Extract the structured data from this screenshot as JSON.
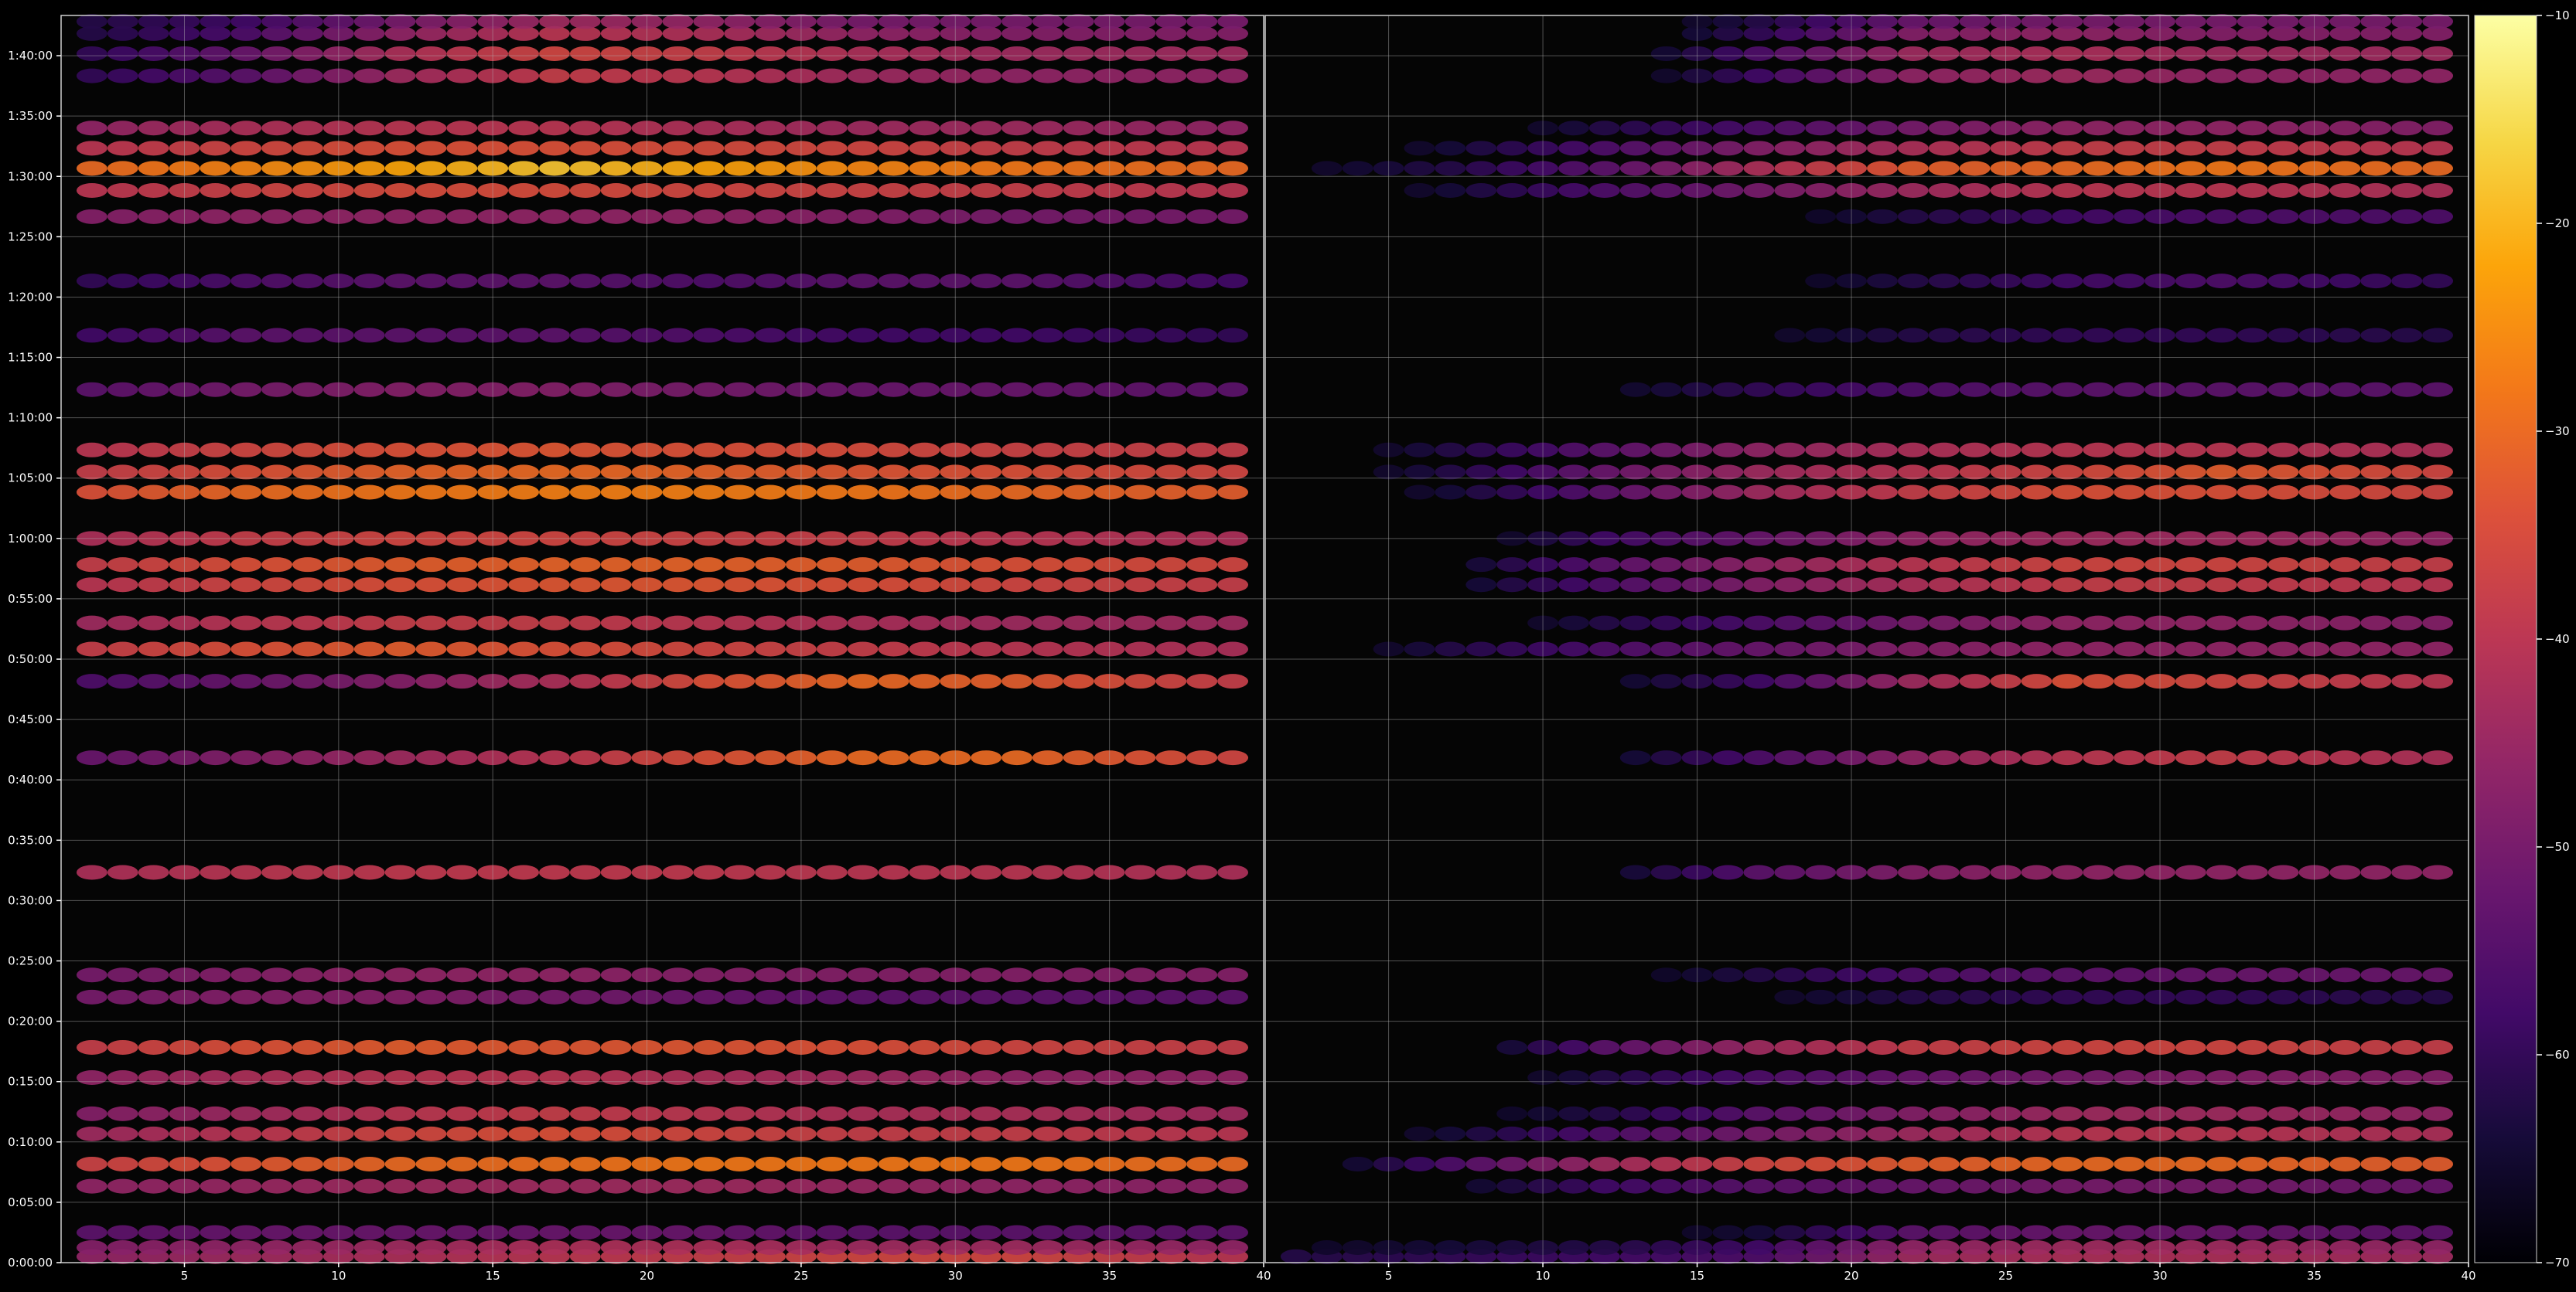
{
  "chart_data": {
    "type": "heatmap",
    "title": "",
    "colormap": "inferno",
    "background": "#000000",
    "grid": true,
    "grid_color": "#b4b4b4",
    "panels": [
      {
        "x_range": [
          1,
          40
        ],
        "xticks": [
          5,
          10,
          15,
          20,
          25,
          30,
          35,
          40
        ],
        "xtick_labels": [
          "5",
          "10",
          "15",
          "20",
          "25",
          "30",
          "35",
          "40"
        ]
      },
      {
        "x_range": [
          1,
          40
        ],
        "xticks": [
          5,
          10,
          15,
          20,
          25,
          30,
          35,
          40
        ],
        "xtick_labels": [
          "5",
          "10",
          "15",
          "20",
          "25",
          "30",
          "35",
          "40"
        ]
      }
    ],
    "y_range_seconds": [
      0,
      6200
    ],
    "ytick_labels": [
      "0:00:00",
      "0:05:00",
      "0:10:00",
      "0:15:00",
      "0:20:00",
      "0:25:00",
      "0:30:00",
      "0:35:00",
      "0:40:00",
      "0:45:00",
      "0:50:00",
      "0:55:00",
      "1:00:00",
      "1:05:00",
      "1:10:00",
      "1:15:00",
      "1:20:00",
      "1:25:00",
      "1:30:00",
      "1:35:00",
      "1:40:00"
    ],
    "ytick_seconds": [
      0,
      300,
      600,
      900,
      1200,
      1500,
      1800,
      2100,
      2400,
      2700,
      3000,
      3300,
      3600,
      3900,
      4200,
      4500,
      4800,
      5100,
      5400,
      5700,
      6000
    ],
    "colorbar": {
      "range": [
        -70,
        -10
      ],
      "ticks": [
        -70,
        -60,
        -50,
        -40,
        -30,
        -20,
        -10
      ],
      "tick_labels": [
        "−70",
        "−60",
        "−50",
        "−40",
        "−30",
        "−20",
        "−10"
      ]
    },
    "rows": [
      {
        "t": 30,
        "a": [
          -46,
          -44,
          -42,
          -40,
          -38,
          -36,
          -36,
          -40
        ],
        "b": [
          -62,
          -60,
          -58,
          -56,
          -44,
          -42,
          -42,
          -44
        ]
      },
      {
        "t": 75,
        "a": [
          -48,
          -46,
          -44,
          -42,
          -42,
          -44,
          -44,
          -46
        ],
        "b": [
          -66,
          -64,
          -62,
          -58,
          -46,
          -44,
          -44,
          -46
        ]
      },
      {
        "t": 150,
        "a": [
          -54,
          -52,
          -52,
          -52,
          -52,
          -54,
          -54,
          -54
        ],
        "b": [
          -70,
          -70,
          -68,
          -64,
          -54,
          -52,
          -52,
          -54
        ]
      },
      {
        "t": 380,
        "a": [
          -46,
          -45,
          -44,
          -44,
          -44,
          -45,
          -46,
          -47
        ],
        "b": [
          -70,
          -66,
          -58,
          -54,
          -52,
          -50,
          -50,
          -52
        ]
      },
      {
        "t": 490,
        "a": [
          -37,
          -33,
          -30,
          -29,
          -28,
          -28,
          -28,
          -30
        ],
        "b": [
          -70,
          -56,
          -44,
          -36,
          -32,
          -30,
          -30,
          -32
        ]
      },
      {
        "t": 640,
        "a": [
          -44,
          -40,
          -36,
          -34,
          -36,
          -38,
          -38,
          -40
        ],
        "b": [
          -70,
          -64,
          -56,
          -50,
          -44,
          -40,
          -40,
          -42
        ]
      },
      {
        "t": 740,
        "a": [
          -48,
          -44,
          -40,
          -38,
          -40,
          -42,
          -42,
          -44
        ],
        "b": [
          -70,
          -68,
          -62,
          -54,
          -48,
          -44,
          -44,
          -46
        ]
      },
      {
        "t": 920,
        "a": [
          -46,
          -42,
          -40,
          -40,
          -42,
          -44,
          -46,
          -46
        ],
        "b": [
          -70,
          -70,
          -62,
          -56,
          -52,
          -50,
          -48,
          -48
        ]
      },
      {
        "t": 1070,
        "a": [
          -38,
          -34,
          -32,
          -33,
          -33,
          -34,
          -36,
          -38
        ],
        "b": [
          -70,
          -70,
          -54,
          -44,
          -38,
          -36,
          -36,
          -38
        ]
      },
      {
        "t": 1320,
        "a": [
          -50,
          -48,
          -48,
          -50,
          -52,
          -54,
          -54,
          -54
        ],
        "b": [
          -70,
          -70,
          -70,
          -66,
          -62,
          -60,
          -60,
          -62
        ]
      },
      {
        "t": 1430,
        "a": [
          -50,
          -48,
          -46,
          -46,
          -48,
          -48,
          -48,
          -48
        ],
        "b": [
          -70,
          -70,
          -68,
          -62,
          -56,
          -54,
          -52,
          -52
        ]
      },
      {
        "t": 1940,
        "a": [
          -42,
          -40,
          -39,
          -39,
          -39,
          -40,
          -40,
          -42
        ],
        "b": [
          -70,
          -70,
          -66,
          -54,
          -48,
          -46,
          -46,
          -46
        ]
      },
      {
        "t": 2510,
        "a": [
          -52,
          -48,
          -44,
          -40,
          -34,
          -30,
          -30,
          -36
        ],
        "b": [
          -70,
          -70,
          -66,
          -56,
          -46,
          -40,
          -38,
          -42
        ]
      },
      {
        "t": 2890,
        "a": [
          -56,
          -52,
          -48,
          -42,
          -34,
          -30,
          -32,
          -38
        ],
        "b": [
          -70,
          -70,
          -66,
          -58,
          -44,
          -34,
          -36,
          -40
        ]
      },
      {
        "t": 3050,
        "a": [
          -38,
          -34,
          -32,
          -34,
          -36,
          -38,
          -40,
          -42
        ],
        "b": [
          -70,
          -62,
          -56,
          -52,
          -48,
          -46,
          -46,
          -46
        ]
      },
      {
        "t": 3180,
        "a": [
          -44,
          -40,
          -38,
          -38,
          -40,
          -42,
          -44,
          -44
        ],
        "b": [
          -70,
          -70,
          -62,
          -56,
          -50,
          -46,
          -46,
          -48
        ]
      },
      {
        "t": 3370,
        "a": [
          -40,
          -36,
          -34,
          -33,
          -33,
          -34,
          -36,
          -38
        ],
        "b": [
          -70,
          -66,
          -56,
          -48,
          -42,
          -38,
          -38,
          -40
        ]
      },
      {
        "t": 3470,
        "a": [
          -38,
          -34,
          -32,
          -31,
          -31,
          -32,
          -34,
          -36
        ],
        "b": [
          -70,
          -66,
          -54,
          -46,
          -40,
          -36,
          -36,
          -38
        ]
      },
      {
        "t": 3600,
        "a": [
          -42,
          -38,
          -36,
          -36,
          -37,
          -38,
          -40,
          -42
        ],
        "b": [
          -70,
          -70,
          -58,
          -52,
          -46,
          -44,
          -44,
          -46
        ]
      },
      {
        "t": 3830,
        "a": [
          -34,
          -30,
          -28,
          -27,
          -27,
          -28,
          -30,
          -32
        ],
        "b": [
          -70,
          -64,
          -54,
          -44,
          -38,
          -34,
          -34,
          -36
        ]
      },
      {
        "t": 3930,
        "a": [
          -38,
          -34,
          -31,
          -30,
          -31,
          -33,
          -34,
          -36
        ],
        "b": [
          -70,
          -62,
          -52,
          -44,
          -40,
          -36,
          -32,
          -36
        ]
      },
      {
        "t": 4040,
        "a": [
          -40,
          -36,
          -34,
          -33,
          -34,
          -35,
          -37,
          -38
        ],
        "b": [
          -70,
          -62,
          -54,
          -46,
          -42,
          -40,
          -40,
          -42
        ]
      },
      {
        "t": 4340,
        "a": [
          -54,
          -50,
          -48,
          -48,
          -50,
          -52,
          -52,
          -54
        ],
        "b": [
          -70,
          -70,
          -66,
          -60,
          -56,
          -54,
          -54,
          -54
        ]
      },
      {
        "t": 4610,
        "a": [
          -58,
          -54,
          -54,
          -54,
          -56,
          -58,
          -58,
          -60
        ],
        "b": [
          -70,
          -70,
          -70,
          -66,
          -62,
          -60,
          -60,
          -62
        ]
      },
      {
        "t": 4880,
        "a": [
          -60,
          -56,
          -54,
          -54,
          -56,
          -54,
          -54,
          -58
        ],
        "b": [
          -70,
          -70,
          -70,
          -68,
          -62,
          -58,
          -56,
          -60
        ]
      },
      {
        "t": 5200,
        "a": [
          -48,
          -46,
          -46,
          -46,
          -46,
          -48,
          -50,
          -50
        ],
        "b": [
          -70,
          -70,
          -70,
          -68,
          -62,
          -58,
          -56,
          -56
        ]
      },
      {
        "t": 5330,
        "a": [
          -40,
          -37,
          -35,
          -35,
          -36,
          -37,
          -38,
          -40
        ],
        "b": [
          -70,
          -64,
          -56,
          -50,
          -44,
          -40,
          -40,
          -42
        ]
      },
      {
        "t": 5440,
        "a": [
          -30,
          -26,
          -22,
          -18,
          -22,
          -26,
          -28,
          -30
        ],
        "b": [
          -66,
          -62,
          -54,
          -42,
          -32,
          -30,
          -28,
          -30
        ]
      },
      {
        "t": 5540,
        "a": [
          -40,
          -36,
          -34,
          -34,
          -35,
          -36,
          -38,
          -40
        ],
        "b": [
          -70,
          -64,
          -56,
          -48,
          -42,
          -38,
          -38,
          -40
        ]
      },
      {
        "t": 5640,
        "a": [
          -46,
          -42,
          -40,
          -40,
          -42,
          -44,
          -44,
          -46
        ],
        "b": [
          -70,
          -70,
          -62,
          -56,
          -50,
          -46,
          -46,
          -48
        ]
      },
      {
        "t": 5900,
        "a": [
          -60,
          -54,
          -44,
          -38,
          -40,
          -44,
          -46,
          -46
        ],
        "b": [
          -70,
          -70,
          -70,
          -58,
          -46,
          -44,
          -46,
          -46
        ]
      },
      {
        "t": 6010,
        "a": [
          -60,
          -52,
          -42,
          -36,
          -38,
          -42,
          -44,
          -44
        ],
        "b": [
          -70,
          -70,
          -70,
          -56,
          -44,
          -42,
          -44,
          -44
        ]
      },
      {
        "t": 6110,
        "a": [
          -62,
          -56,
          -46,
          -40,
          -42,
          -46,
          -48,
          -48
        ],
        "b": [
          -70,
          -70,
          -70,
          -60,
          -48,
          -46,
          -48,
          -48
        ]
      },
      {
        "t": 6170,
        "a": [
          -62,
          -58,
          -50,
          -44,
          -46,
          -50,
          -50,
          -50
        ],
        "b": [
          -70,
          -70,
          -70,
          -62,
          -52,
          -50,
          -50,
          -50
        ]
      }
    ]
  }
}
